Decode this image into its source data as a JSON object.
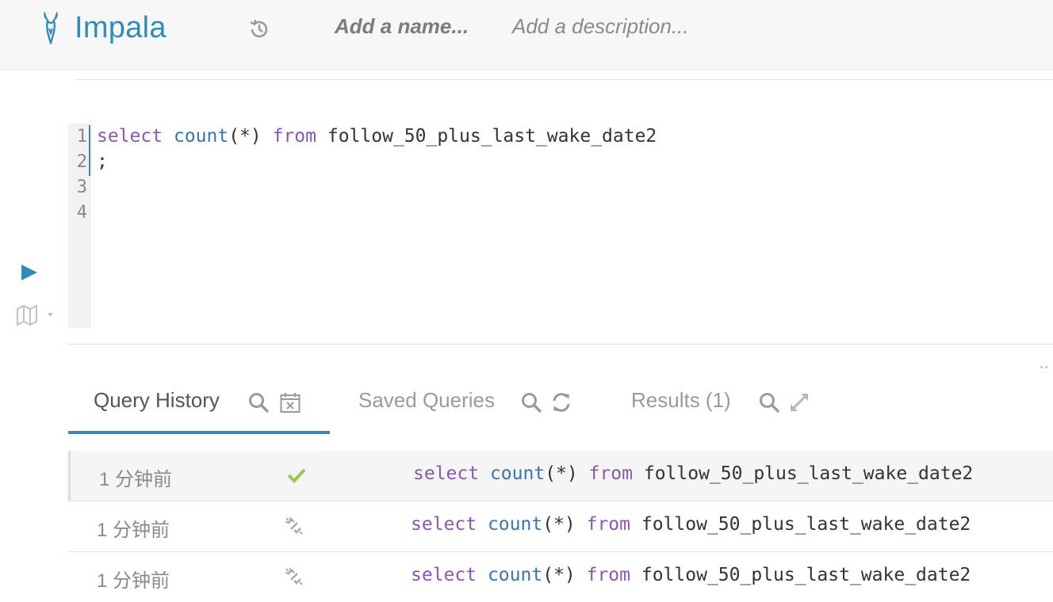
{
  "header": {
    "app_title": "Impala",
    "name_placeholder": "Add a name...",
    "description_placeholder": "Add a description..."
  },
  "editor": {
    "line_numbers": [
      "1",
      "2",
      "3",
      "4"
    ],
    "lines": [
      {
        "keyword1": "select",
        "func": "count",
        "paren": "(*)",
        "keyword2": "from",
        "table": "follow_50_plus_last_wake_date2"
      },
      {
        "text": ";"
      }
    ]
  },
  "tabs": [
    {
      "label": "Query History"
    },
    {
      "label": "Saved Queries"
    },
    {
      "label": "Results (1)"
    }
  ],
  "history": [
    {
      "time": "1 分钟前",
      "status_icon": "check-icon",
      "keyword1": "select",
      "func": "count",
      "paren": "(*)",
      "keyword2": "from",
      "table": "follow_50_plus_last_wake_date2"
    },
    {
      "time": "1 分钟前",
      "status_icon": "broken-link-icon",
      "keyword1": "select",
      "func": "count",
      "paren": "(*)",
      "keyword2": "from",
      "table": "follow_50_plus_last_wake_date2"
    },
    {
      "time": "1 分钟前",
      "status_icon": "broken-link-icon",
      "keyword1": "select",
      "func": "count",
      "paren": "(*)",
      "keyword2": "from",
      "table": "follow_50_plus_last_wake_date2"
    }
  ],
  "colors": {
    "accent": "#338bb8",
    "keyword": "#8959a8",
    "function": "#3e74a8",
    "success": "#9ac75c"
  }
}
